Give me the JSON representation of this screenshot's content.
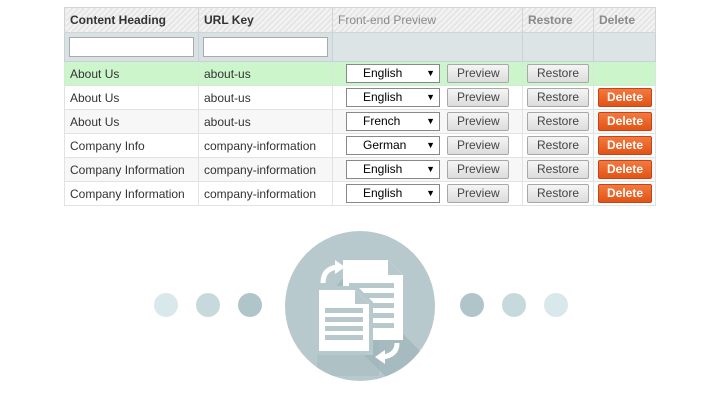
{
  "grid": {
    "headers": {
      "content_heading": "Content Heading",
      "url_key": "URL Key",
      "preview": "Front-end Preview",
      "restore": "Restore",
      "delete": "Delete"
    },
    "filters": {
      "content_heading": "",
      "url_key": ""
    },
    "preview_label": "Preview",
    "restore_label": "Restore",
    "delete_label": "Delete",
    "rows": [
      {
        "heading": "About Us",
        "url": "about-us",
        "language": "English",
        "deletable": false,
        "highlighted": true
      },
      {
        "heading": "About Us",
        "url": "about-us",
        "language": "English",
        "deletable": true
      },
      {
        "heading": "About Us",
        "url": "about-us",
        "language": "French",
        "deletable": true
      },
      {
        "heading": "Company Info",
        "url": "company-information",
        "language": "German",
        "deletable": true
      },
      {
        "heading": "Company Information",
        "url": "company-information",
        "language": "English",
        "deletable": true
      },
      {
        "heading": "Company Information",
        "url": "company-information",
        "language": "English",
        "deletable": true
      }
    ]
  },
  "colors": {
    "highlight_row": "#ccf5cc",
    "delete_button": "#e8621f",
    "circle": "#b7c9cd",
    "dots": [
      "#d9e8ea",
      "#c6d9dc",
      "#afc5c9"
    ]
  },
  "illustration": {
    "icon": "copy-documents-icon"
  }
}
